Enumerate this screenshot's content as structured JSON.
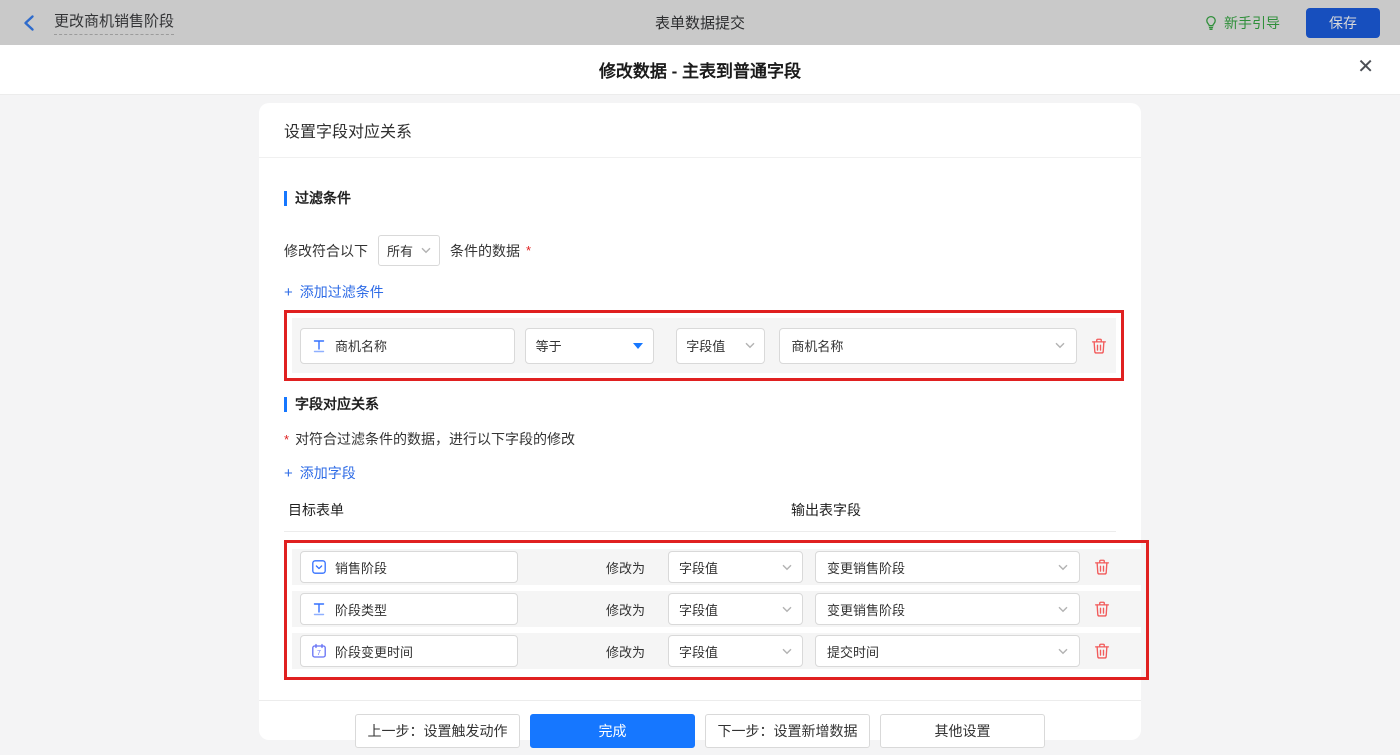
{
  "topbar": {
    "back_label": "更改商机销售阶段",
    "center_title": "表单数据提交",
    "guide_label": "新手引导",
    "save_label": "保存"
  },
  "dialog": {
    "title": "修改数据 - 主表到普通字段",
    "close_glyph": "✕",
    "card_title": "设置字段对应关系",
    "filter_section": {
      "title": "过滤条件",
      "line_prefix": "修改符合以下",
      "match_value": "所有",
      "line_suffix": "条件的数据",
      "required_mark": "*",
      "add_label": "添加过滤条件",
      "plus_glyph": "+",
      "row": {
        "field": "商机名称",
        "operator": "等于",
        "value_type": "字段值",
        "value": "商机名称"
      }
    },
    "mapping_section": {
      "title": "字段对应关系",
      "required_mark": "*",
      "description": "对符合过滤条件的数据，进行以下字段的修改",
      "add_label": "添加字段",
      "plus_glyph": "+",
      "col_target": "目标表单",
      "col_output": "输出表字段",
      "modify_label": "修改为",
      "date_icon_number": "7",
      "rows": [
        {
          "field": "销售阶段",
          "value_type": "字段值",
          "output": "变更销售阶段"
        },
        {
          "field": "阶段类型",
          "value_type": "字段值",
          "output": "变更销售阶段"
        },
        {
          "field": "阶段变更时间",
          "value_type": "字段值",
          "output": "提交时间"
        }
      ]
    },
    "footer": {
      "prev_label": "上一步：设置触发动作",
      "done_label": "完成",
      "next_label": "下一步：设置新增数据",
      "other_label": "其他设置"
    }
  },
  "colors": {
    "accent_blue": "#1677ff",
    "link_blue": "#2e6be6",
    "annotation_red": "#e02020",
    "trash_red": "#f25b5b",
    "guide_green": "#2f8f3a",
    "topbar_dim": "#c9c9c9"
  }
}
